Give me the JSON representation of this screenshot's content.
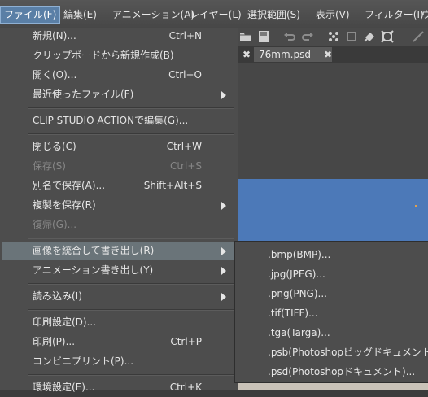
{
  "menubar": {
    "items": [
      {
        "label": "ファイル(F)",
        "active": true
      },
      {
        "label": "編集(E)"
      },
      {
        "label": "アニメーション(A)"
      },
      {
        "label": "レイヤー(L)"
      },
      {
        "label": "選択範囲(S)"
      },
      {
        "label": "表示(V)"
      },
      {
        "label": "フィルター(I)"
      },
      {
        "label": "ウ"
      }
    ]
  },
  "tabs": {
    "doc_title": "76mm.psd",
    "close_glyph": "✖"
  },
  "file_menu": {
    "items": [
      {
        "label": "新規(N)...",
        "shortcut": "Ctrl+N"
      },
      {
        "label": "クリップボードから新規作成(B)",
        "shortcut": ""
      },
      {
        "label": "開く(O)...",
        "shortcut": "Ctrl+O"
      },
      {
        "label": "最近使ったファイル(F)",
        "shortcut": ""
      },
      {
        "label": "CLIP STUDIO ACTIONで編集(G)...",
        "shortcut": ""
      },
      {
        "label": "閉じる(C)",
        "shortcut": "Ctrl+W"
      },
      {
        "label": "保存(S)",
        "shortcut": "Ctrl+S"
      },
      {
        "label": "別名で保存(A)...",
        "shortcut": "Shift+Alt+S"
      },
      {
        "label": "複製を保存(R)",
        "shortcut": ""
      },
      {
        "label": "復帰(G)...",
        "shortcut": ""
      },
      {
        "label": "画像を統合して書き出し(R)",
        "shortcut": ""
      },
      {
        "label": "アニメーション書き出し(Y)",
        "shortcut": ""
      },
      {
        "label": "読み込み(I)",
        "shortcut": ""
      },
      {
        "label": "印刷設定(D)...",
        "shortcut": ""
      },
      {
        "label": "印刷(P)...",
        "shortcut": "Ctrl+P"
      },
      {
        "label": "コンビニプリント(P)...",
        "shortcut": ""
      },
      {
        "label": "環境設定(E)...",
        "shortcut": "Ctrl+K"
      }
    ]
  },
  "export_submenu": {
    "items": [
      {
        "label": ".bmp(BMP)..."
      },
      {
        "label": ".jpg(JPEG)..."
      },
      {
        "label": ".png(PNG)..."
      },
      {
        "label": ".tif(TIFF)..."
      },
      {
        "label": ".tga(Targa)..."
      },
      {
        "label": ".psb(Photoshopビッグドキュメント)..."
      },
      {
        "label": ".psd(Photoshopドキュメント)..."
      }
    ]
  }
}
